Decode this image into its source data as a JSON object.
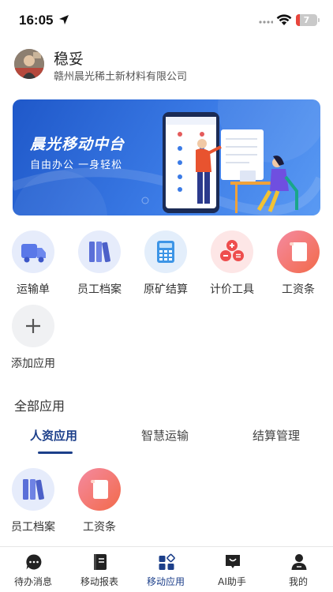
{
  "status_bar": {
    "time": "16:05",
    "battery": "7"
  },
  "profile": {
    "name": "稳妥",
    "company": "赣州晨光稀土新材料有限公司"
  },
  "banner": {
    "title": "晨光移动中台",
    "subtitle": "自由办公 一身轻松"
  },
  "quick_apps": [
    {
      "label": "运输单",
      "icon": "truck-icon"
    },
    {
      "label": "员工档案",
      "icon": "books-icon"
    },
    {
      "label": "原矿结算",
      "icon": "calculator-icon"
    },
    {
      "label": "计价工具",
      "icon": "math-ops-icon"
    },
    {
      "label": "工资条",
      "icon": "scroll-icon"
    },
    {
      "label": "添加应用",
      "icon": "plus-icon"
    }
  ],
  "all_apps": {
    "title": "全部应用",
    "tabs": [
      {
        "label": "人资应用",
        "active": true
      },
      {
        "label": "智慧运输",
        "active": false
      },
      {
        "label": "结算管理",
        "active": false
      }
    ],
    "items": [
      {
        "label": "员工档案",
        "icon": "books-icon"
      },
      {
        "label": "工资条",
        "icon": "scroll-icon"
      }
    ]
  },
  "bottom_nav": [
    {
      "label": "待办消息",
      "icon": "chat-icon",
      "active": false
    },
    {
      "label": "移动报表",
      "icon": "report-icon",
      "active": false
    },
    {
      "label": "移动应用",
      "icon": "apps-icon",
      "active": true
    },
    {
      "label": "AI助手",
      "icon": "ai-bag-icon",
      "active": false
    },
    {
      "label": "我的",
      "icon": "person-icon",
      "active": false
    }
  ],
  "colors": {
    "accent": "#1c3f8a",
    "banner": "#2f6fdc",
    "status_battery": "#e8453c"
  }
}
